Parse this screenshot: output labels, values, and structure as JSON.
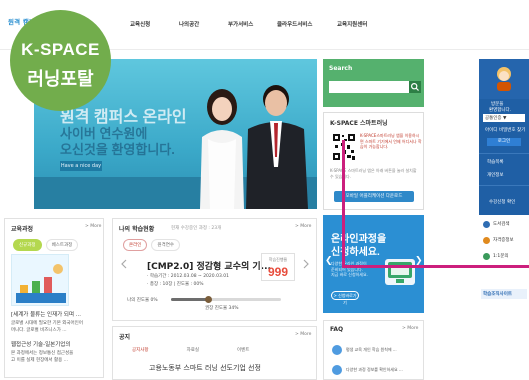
{
  "header": {
    "logo": "원격 캠퍼스 HRD Center",
    "nav": [
      "교육신청",
      "나의공간",
      "부가서비스",
      "클라우드서비스",
      "교육지원센터"
    ]
  },
  "badge": {
    "line1": "K-SPACE",
    "line2": "러닝포탈"
  },
  "hero": {
    "title": "원격 캠퍼스 온라인",
    "line1": "사이버 연수원에",
    "line2": "오신것을 환영합니다.",
    "tag": "Have a nice day"
  },
  "search": {
    "label": "Search",
    "placeholder": "",
    "button_icon": "search-icon"
  },
  "smart": {
    "title": "K-SPACE 스마트러닝",
    "desc": "K-SPACE스마트러닝 앱을 이용하시면 스마트 기기에서 언제 어디서나 학습이 가능합니다.",
    "note": "K-SPACE 스마트러닝 앱은 아래 버튼을 눌러 설치할 수 있습니다.",
    "button": "모바일 어플리케이션 다운로드"
  },
  "right_sidebar": {
    "greeting_line1": "방문을",
    "greeting_line2": "환영합니다.",
    "select_value": "공통인증 ▼",
    "id_label": "아이디",
    "login_note": "비밀번호 찾기",
    "login_button": "로그인",
    "item1": "학습목록",
    "item2": "개인정보",
    "item3": "수강신청 확인"
  },
  "course_panel": {
    "title": "교육과정",
    "more": "> More",
    "tabs": [
      "신규과정",
      "베스트과정"
    ],
    "item1": "[세계가 물류는 인재가 되며 ...",
    "item1_desc": "글로벌 시대에 필요한 기본 외국어인어",
    "item1_desc2": "머니다. 글로벌 비즈니스가 ...",
    "item2": "웹접근성 기술-일본기업의",
    "item2_desc": "본 과정에서는 정보통신 접근성을",
    "item2_desc2": "고 이를 실제 현장에서 활용 ..."
  },
  "my_learning": {
    "title": "나의 학습현황",
    "subtitle": "현재 수강중인 과정 : 23개",
    "more": "> More",
    "tabs": [
      "온라인",
      "원격연수"
    ],
    "course": "[CMP2.0] 정감형 교수의 기...",
    "period": "· 학습기간 : 2012.03.08 ~ 2020.03.01",
    "detail": "· 총장 : 10장 | 진도율 : 00%",
    "score_label": "학습진행율",
    "score": "999",
    "progress_label": "나의 진도율 0%",
    "progress_value": 0.34,
    "progress_caption": "권장 진도율 34%"
  },
  "notice": {
    "title": "공지",
    "more": "> More",
    "tabs": [
      "공지사항",
      "자료실",
      "이벤트"
    ],
    "item1": "고용노동부 스마트 러닝 선도기업 선정"
  },
  "promo": {
    "title_line1": "온라인과정을",
    "title_line2": "신청하세요.",
    "desc1": "다양한 온라인 과정이",
    "desc2": "준비되어 있습니다.",
    "desc3": "지금 바로 신청하세요.",
    "button": "> 신청바로가기"
  },
  "faq": {
    "title": "FAQ",
    "more": "> More",
    "item1": "평생 교육 개인 학습 원칙에 ...",
    "item2": "다양한 과정 정보를 확인하세요 ..."
  },
  "right_bottom": {
    "item1": "도서검색",
    "item2": "자격증정보",
    "item3": "1:1문의",
    "item4": "학습조직사이트"
  },
  "colors": {
    "accent_green": "#72ad4c",
    "search_green": "#55b16e",
    "sidebar_blue": "#1f5fa5",
    "highlight_magenta": "#cc1f7d",
    "score_red": "#e74c3c"
  }
}
